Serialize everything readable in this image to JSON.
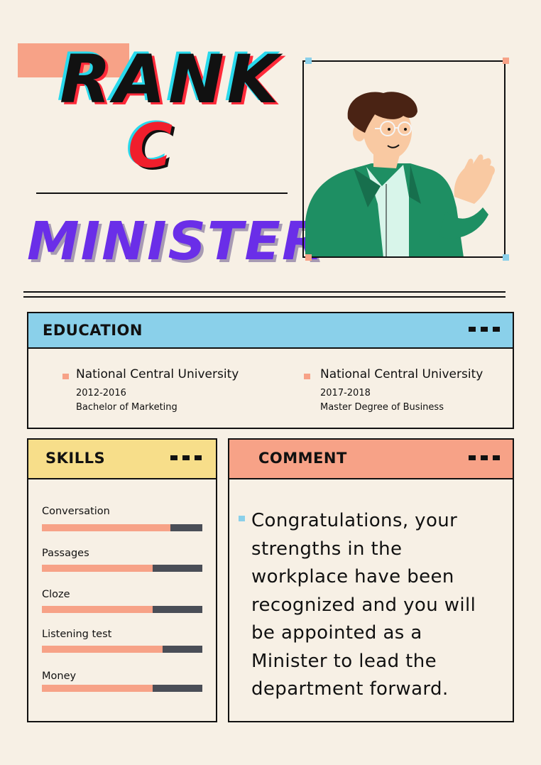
{
  "header": {
    "rank_word": "RANK",
    "rank_letter": "C",
    "role": "MINISTER"
  },
  "education": {
    "title": "EDUCATION",
    "entries": [
      {
        "school": "National Central University",
        "years": "2012-2016",
        "degree": "Bachelor of Marketing"
      },
      {
        "school": "National Central University",
        "years": "2017-2018",
        "degree": "Master Degree of Business"
      }
    ]
  },
  "skills": {
    "title": "SKILLS",
    "items": [
      {
        "label": "Conversation",
        "level": 0.8
      },
      {
        "label": "Passages",
        "level": 0.69
      },
      {
        "label": "Cloze",
        "level": 0.69
      },
      {
        "label": "Listening test",
        "level": 0.75
      },
      {
        "label": "Money",
        "level": 0.69
      }
    ]
  },
  "comment": {
    "title": "COMMENT",
    "text": "Congratulations, your strengths in the workplace have been recognized and you will be appointed as a Minister to lead the department forward."
  },
  "colors": {
    "background": "#f7f0e5",
    "salmon": "#f7a287",
    "sky": "#8ad0ea",
    "yellow": "#f7de8a",
    "purple": "#6a2ee8",
    "red": "#f01e2c",
    "dark_bar": "#4a4e57"
  },
  "icons": [
    "avatar-illustration",
    "menu-dots-icon",
    "bullet-square-icon"
  ]
}
